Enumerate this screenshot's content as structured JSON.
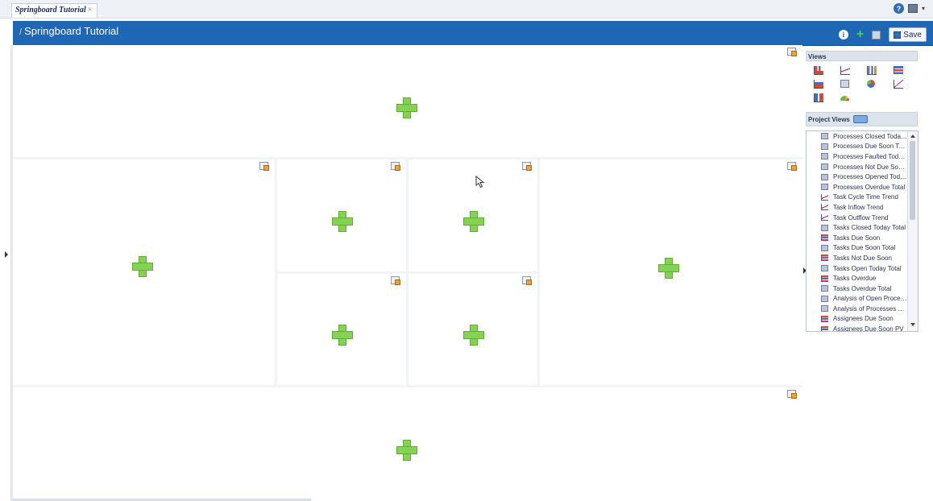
{
  "tab": {
    "label": "Springboard Tutorial",
    "close": "×"
  },
  "top_right": {
    "help_icon": "?",
    "caret": "▾"
  },
  "header": {
    "title": "Springboard Tutorial",
    "info_icon": "i",
    "add_icon": "+",
    "save_label": "Save"
  },
  "views_panel": {
    "heading": "Views",
    "view_types": [
      "bar-chart",
      "line-chart",
      "column-chart",
      "horizontal-bar-chart",
      "area-chart",
      "table",
      "pie-chart",
      "scatter-chart",
      "combo-chart",
      "gauge"
    ]
  },
  "project_views": {
    "heading": "Project Views",
    "items": [
      {
        "label": "Processes Closed Today ...",
        "icon": "table"
      },
      {
        "label": "Processes Due Soon Tot...",
        "icon": "table"
      },
      {
        "label": "Processes Faulted Today...",
        "icon": "table"
      },
      {
        "label": "Processes Not Due Soon ...",
        "icon": "table"
      },
      {
        "label": "Processes Opened Toda...",
        "icon": "table"
      },
      {
        "label": "Processes Overdue Total",
        "icon": "table"
      },
      {
        "label": "Task Cycle Time Trend",
        "icon": "trend"
      },
      {
        "label": "Task Inflow Trend",
        "icon": "trend"
      },
      {
        "label": "Task Outflow Trend",
        "icon": "trend"
      },
      {
        "label": "Tasks Closed Today Total",
        "icon": "table"
      },
      {
        "label": "Tasks Due Soon",
        "icon": "bar"
      },
      {
        "label": "Tasks Due Soon Total",
        "icon": "table"
      },
      {
        "label": "Tasks Not Due Soon",
        "icon": "bar"
      },
      {
        "label": "Tasks Open Today Total",
        "icon": "table"
      },
      {
        "label": "Tasks Overdue",
        "icon": "bar"
      },
      {
        "label": "Tasks Overdue Total",
        "icon": "table"
      },
      {
        "label": "Analysis of Open Proces...",
        "icon": "table"
      },
      {
        "label": "Analysis of Processes Cl...",
        "icon": "table"
      },
      {
        "label": "Assignees Due Soon",
        "icon": "bar"
      },
      {
        "label": "Assignees Due Soon PV",
        "icon": "bar"
      }
    ]
  },
  "canvas": {
    "cell_count": 8,
    "cell_action": "add-view"
  }
}
